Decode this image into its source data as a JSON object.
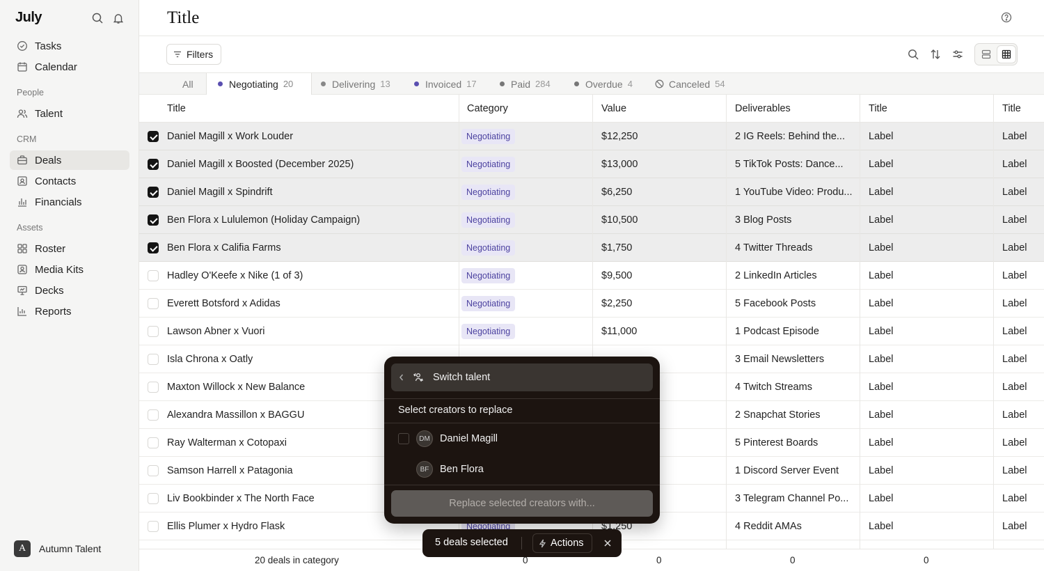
{
  "app": {
    "logo": "July"
  },
  "sidebar": {
    "top_items": [
      {
        "label": "Tasks",
        "icon": "check-circle-icon"
      },
      {
        "label": "Calendar",
        "icon": "calendar-icon"
      }
    ],
    "sections": [
      {
        "title": "People",
        "items": [
          {
            "label": "Talent",
            "icon": "people-icon"
          }
        ]
      },
      {
        "title": "CRM",
        "items": [
          {
            "label": "Deals",
            "icon": "briefcase-icon",
            "active": true
          },
          {
            "label": "Contacts",
            "icon": "contact-card-icon"
          },
          {
            "label": "Financials",
            "icon": "bar-chart-icon"
          }
        ]
      },
      {
        "title": "Assets",
        "items": [
          {
            "label": "Roster",
            "icon": "grid-icon"
          },
          {
            "label": "Media Kits",
            "icon": "portrait-icon"
          },
          {
            "label": "Decks",
            "icon": "presentation-icon"
          },
          {
            "label": "Reports",
            "icon": "chart-icon"
          }
        ]
      }
    ],
    "account": {
      "avatar_letter": "A",
      "name": "Autumn Talent"
    }
  },
  "header": {
    "title": "Title"
  },
  "toolbar": {
    "filters_label": "Filters"
  },
  "tabs": [
    {
      "label": "All",
      "count": ""
    },
    {
      "label": "Negotiating",
      "count": "20",
      "dot": "#5a4fb0",
      "active": true
    },
    {
      "label": "Delivering",
      "count": "13",
      "dot": "#888888"
    },
    {
      "label": "Invoiced",
      "count": "17",
      "dot": "#5a4fb0"
    },
    {
      "label": "Paid",
      "count": "284",
      "dot": "#777777"
    },
    {
      "label": "Overdue",
      "count": "4",
      "dot": "#777777"
    },
    {
      "label": "Canceled",
      "count": "54",
      "icon": "ban-icon"
    }
  ],
  "table": {
    "columns": [
      "Title",
      "Category",
      "Value",
      "Deliverables",
      "Title",
      "Title"
    ],
    "rows": [
      {
        "selected": true,
        "title": "Daniel Magill x Work Louder",
        "category": "Negotiating",
        "value": "$12,250",
        "deliverables": "2 IG Reels: Behind the...",
        "c5": "Label",
        "c6": "Label"
      },
      {
        "selected": true,
        "title": "Daniel Magill x Boosted (December 2025)",
        "category": "Negotiating",
        "value": "$13,000",
        "deliverables": "5 TikTok Posts: Dance...",
        "c5": "Label",
        "c6": "Label"
      },
      {
        "selected": true,
        "title": "Daniel Magill x Spindrift",
        "category": "Negotiating",
        "value": "$6,250",
        "deliverables": "1 YouTube Video: Produ...",
        "c5": "Label",
        "c6": "Label"
      },
      {
        "selected": true,
        "title": "Ben Flora x Lululemon (Holiday Campaign)",
        "category": "Negotiating",
        "value": "$10,500",
        "deliverables": "3 Blog Posts",
        "c5": "Label",
        "c6": "Label"
      },
      {
        "selected": true,
        "title": "Ben Flora x Califia Farms",
        "category": "Negotiating",
        "value": "$1,750",
        "deliverables": "4 Twitter Threads",
        "c5": "Label",
        "c6": "Label"
      },
      {
        "selected": false,
        "title": "Hadley O'Keefe x Nike (1 of 3)",
        "category": "Negotiating",
        "value": "$9,500",
        "deliverables": "2 LinkedIn Articles",
        "c5": "Label",
        "c6": "Label"
      },
      {
        "selected": false,
        "title": "Everett Botsford x Adidas",
        "category": "Negotiating",
        "value": "$2,250",
        "deliverables": "5 Facebook Posts",
        "c5": "Label",
        "c6": "Label"
      },
      {
        "selected": false,
        "title": "Lawson Abner x Vuori",
        "category": "Negotiating",
        "value": "$11,000",
        "deliverables": "1 Podcast Episode",
        "c5": "Label",
        "c6": "Label"
      },
      {
        "selected": false,
        "title": "Isla Chrona x Oatly",
        "category": "",
        "value": "",
        "deliverables": "3 Email Newsletters",
        "c5": "Label",
        "c6": "Label"
      },
      {
        "selected": false,
        "title": "Maxton Willock x New Balance",
        "category": "",
        "value": "",
        "deliverables": "4 Twitch Streams",
        "c5": "Label",
        "c6": "Label"
      },
      {
        "selected": false,
        "title": "Alexandra Massillon x BAGGU",
        "category": "",
        "value": "",
        "deliverables": "2 Snapchat Stories",
        "c5": "Label",
        "c6": "Label"
      },
      {
        "selected": false,
        "title": "Ray Walterman x Cotopaxi",
        "category": "",
        "value": "",
        "deliverables": "5 Pinterest Boards",
        "c5": "Label",
        "c6": "Label"
      },
      {
        "selected": false,
        "title": "Samson Harrell x Patagonia",
        "category": "",
        "value": "",
        "deliverables": "1 Discord Server Event",
        "c5": "Label",
        "c6": "Label"
      },
      {
        "selected": false,
        "title": "Liv Bookbinder x The North Face",
        "category": "",
        "value": "",
        "deliverables": "3 Telegram Channel Po...",
        "c5": "Label",
        "c6": "Label"
      },
      {
        "selected": false,
        "title": "Ellis Plumer x Hydro Flask",
        "category": "Negotiating",
        "value": "$1,250",
        "deliverables": "4 Reddit AMAs",
        "c5": "Label",
        "c6": "Label"
      }
    ],
    "footer": {
      "summary": "20 deals in category",
      "values": [
        "0",
        "0",
        "0",
        "0"
      ]
    }
  },
  "popover": {
    "header_label": "Switch talent",
    "subtitle": "Select creators to replace",
    "creators": [
      {
        "initials": "DM",
        "name": "Daniel Magill",
        "checkbox": true
      },
      {
        "initials": "BF",
        "name": "Ben Flora",
        "checkbox": false
      }
    ],
    "button_label": "Replace selected creators with..."
  },
  "selection_bar": {
    "count_label": "5 deals selected",
    "actions_label": "Actions"
  }
}
